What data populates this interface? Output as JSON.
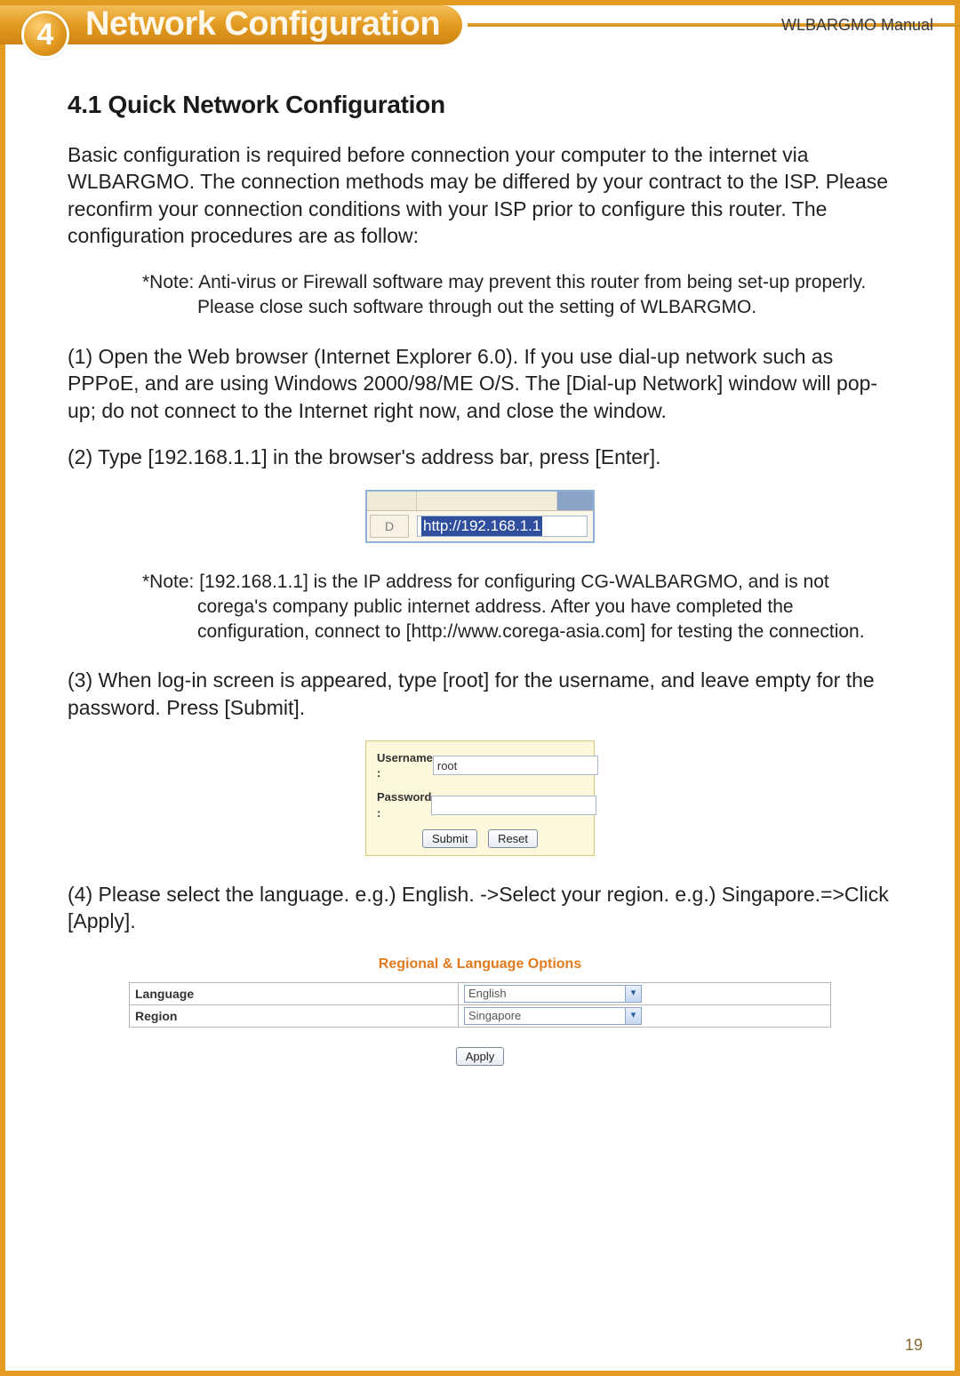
{
  "header": {
    "chapter_number": "4",
    "chapter_title": "Network Configuration",
    "manual_name": "WLBARGMO Manual"
  },
  "section_heading": "4.1 Quick Network Configuration",
  "intro_paragraph": "Basic configuration is required before connection your computer to the internet via WLBARGMO. The connection methods may be differed by your contract to the ISP. Please reconfirm your connection conditions with your ISP prior to configure this router. The configuration procedures are as follow:",
  "note1_label": "*Note:",
  "note1_body": "Anti-virus or Firewall software may prevent this router from being set-up properly. Please close such software through out the setting of WLBARGMO.",
  "step1": "(1) Open the Web browser (Internet Explorer 6.0). If you use dial-up network such as PPPoE, and are using Windows 2000/98/ME O/S. The [Dial-up Network] window will pop-up; do not connect to the Internet right now, and close the window.",
  "step2": "(2) Type [192.168.1.1] in the browser's address bar, press [Enter].",
  "address_bar": {
    "icon_text": "D",
    "url": "http://192.168.1.1"
  },
  "note2_label": "*Note:",
  "note2_body": "[192.168.1.1] is the IP address for configuring CG-WALBARGMO, and is not corega's company public internet address. After you have completed the configuration, connect to [http://www.corega-asia.com] for testing the connection.",
  "step3": "(3) When log-in screen is appeared, type [root] for the username, and leave empty for the password. Press [Submit].",
  "login_box": {
    "username_label": "Username :",
    "username_value": "root",
    "password_label": "Password :",
    "password_value": "",
    "submit_label": "Submit",
    "reset_label": "Reset"
  },
  "step4": "(4) Please select the language. e.g.) English. ->Select your region. e.g.) Singapore.=>Click  [Apply].",
  "regional": {
    "title": "Regional & Language Options",
    "language_label": "Language",
    "language_value": "English",
    "region_label": "Region",
    "region_value": "Singapore",
    "apply_label": "Apply"
  },
  "page_number": "19"
}
